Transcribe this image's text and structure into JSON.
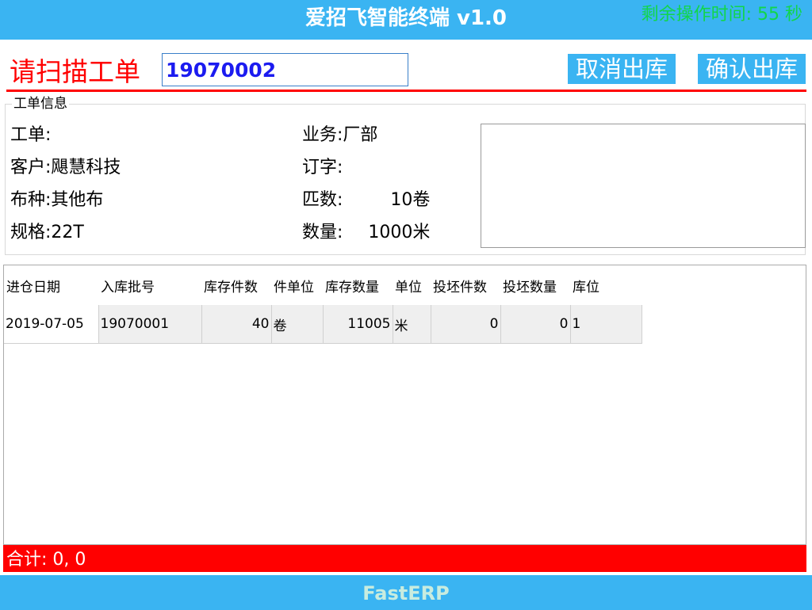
{
  "header": {
    "title": "爱招飞智能终端 v1.0",
    "countdown": "剩余操作时间: 55 秒"
  },
  "scan": {
    "label": "请扫描工单",
    "value": "19070002"
  },
  "actions": {
    "cancel_label": "取消出库",
    "confirm_label": "确认出库"
  },
  "work_order_info": {
    "legend": "工单信息",
    "order_label": "工单:",
    "order_value": "",
    "customer_label": "客户:",
    "customer_value": "飓慧科技",
    "fabric_label": "布种:",
    "fabric_value": "其他布",
    "spec_label": "规格:",
    "spec_value": "22T",
    "business_label": "业务:",
    "business_value": "厂部",
    "booking_label": "订字:",
    "booking_value": "",
    "rolls_label": "匹数:",
    "rolls_value": "10卷",
    "quantity_label": "数量:",
    "quantity_value": "1000米"
  },
  "table": {
    "columns": [
      "进仓日期",
      "入库批号",
      "库存件数",
      "件单位",
      "库存数量",
      "单位",
      "投坯件数",
      "投坯数量",
      "库位"
    ],
    "rows": [
      [
        "2019-07-05",
        "19070001",
        "40",
        "卷",
        "11005",
        "米",
        "0",
        "0",
        "1"
      ]
    ]
  },
  "summary": {
    "text": "合计: 0,   0"
  },
  "footer": {
    "brand": "FastERP"
  },
  "colors": {
    "accent": "#3ab4f2",
    "alert": "#ff0000",
    "countdown": "#11d64a"
  }
}
